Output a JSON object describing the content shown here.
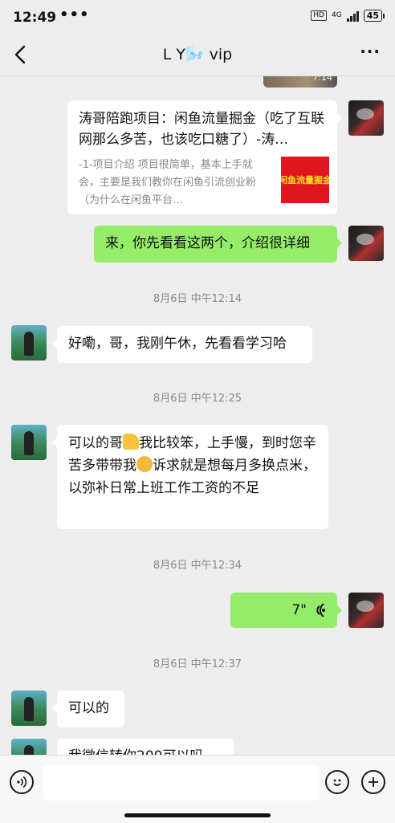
{
  "status_bar": {
    "time": "12:49",
    "dots": "•••",
    "hd": "HD",
    "network": "4G",
    "battery": "45"
  },
  "header": {
    "title": "L Y🌬️ vip"
  },
  "top_media": {
    "duration": "7:14"
  },
  "messages": [
    {
      "type": "card",
      "side": "right",
      "title": "涛哥陪跑项目：闲鱼流量掘金（吃了互联网那么多苦，也该吃口糖了）-涛…",
      "desc": "-1-项目介绍 项目很简单，基本上手就会，主要是我们教你在闲鱼引流创业粉（为什么在闲鱼平台…",
      "thumb_text": "闲鱼流量掘金"
    },
    {
      "type": "text",
      "side": "right",
      "text": "来，你先看看这两个，介绍很详细"
    },
    {
      "type": "time",
      "text": "8月6日 中午12:14"
    },
    {
      "type": "text",
      "side": "left",
      "text": "好嘞，哥，我刚午休，先看看学习哈"
    },
    {
      "type": "time",
      "text": "8月6日 中午12:25"
    },
    {
      "type": "text",
      "side": "left",
      "part1": "可以的哥",
      "part2": "我比较笨，上手慢，到时您辛苦多带带我",
      "part3": "诉求就是想每月多换点米，以弥补日常上班工作工资的不足"
    },
    {
      "type": "time",
      "text": "8月6日 中午12:34"
    },
    {
      "type": "voice",
      "side": "right",
      "duration": "7\""
    },
    {
      "type": "time",
      "text": "8月6日 中午12:37"
    },
    {
      "type": "text",
      "side": "left",
      "text": "可以的"
    },
    {
      "type": "text",
      "side": "left",
      "text": "我微信转你200可以吗"
    }
  ],
  "colors": {
    "background": "#ededed",
    "sent_bubble": "#95ec69",
    "received_bubble": "#ffffff"
  }
}
